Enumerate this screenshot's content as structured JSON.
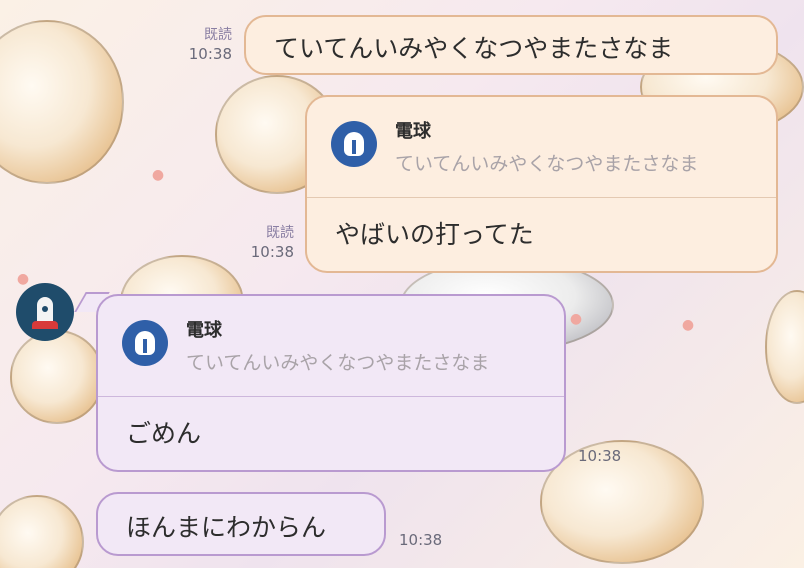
{
  "wallpaper": {
    "colors": {
      "cat": "#e9c596",
      "paw": "#f0a8a0"
    }
  },
  "messages": [
    {
      "direction": "out",
      "read_label": "既読",
      "time": "10:38",
      "text": "ていてんいみやくなつやまたさなま"
    },
    {
      "direction": "out",
      "read_label": "既読",
      "time": "10:38",
      "reply_to": {
        "name": "電球",
        "quote": "ていてんいみやくなつやまたさなま"
      },
      "text": "やばいの打ってた"
    },
    {
      "direction": "in",
      "time": "10:38",
      "reply_to": {
        "name": "電球",
        "quote": "ていてんいみやくなつやまたさなま"
      },
      "text": "ごめん"
    },
    {
      "direction": "in",
      "time": "10:38",
      "text": "ほんまにわからん"
    }
  ],
  "contact": {
    "avatar_icon": "rocket-icon",
    "avatar_color": "#1f4c6b"
  },
  "reply_icon": "lightbulb-icon",
  "colors": {
    "out_bubble": "#fdeee0",
    "out_border": "#e3b894",
    "in_bubble": "#f2e8f6",
    "in_border": "#b99ad0",
    "reply_icon_bg": "#2f5fa8"
  }
}
